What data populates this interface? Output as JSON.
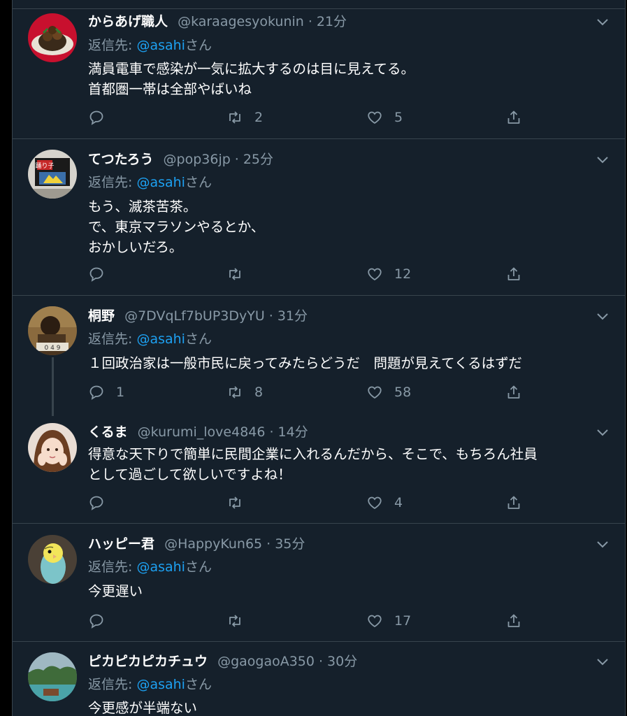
{
  "reply_prefix": "返信先: ",
  "reply_suffix": "さん",
  "tweets": [
    {
      "name": "からあげ職人",
      "handle": "@karaagesyokunin",
      "time": "21分",
      "reply_to": "@asahi",
      "body": "満員電車で感染が一気に拡大するのは目に見えてる。\n首都圏一帯は全部やばいね",
      "replies": "",
      "retweets": "2",
      "likes": "5",
      "avatar_icon": "food-avatar"
    },
    {
      "name": "てつたろう",
      "handle": "@pop36jp",
      "time": "25分",
      "reply_to": "@asahi",
      "body": "もう、滅茶苦茶。\nで、東京マラソンやるとか、\nおかしいだろ。",
      "replies": "",
      "retweets": "",
      "likes": "12",
      "avatar_icon": "tv-screen-avatar",
      "avatar_text": "踊り子"
    },
    {
      "name": "桐野",
      "handle": "@7DVqLf7bUP3DyYU",
      "time": "31分",
      "reply_to": "@asahi",
      "body": "１回政治家は一般市民に戻ってみたらどうだ　問題が見えてくるはずだ",
      "replies": "1",
      "retweets": "8",
      "likes": "58",
      "avatar_icon": "person-avatar"
    },
    {
      "name": "くるま",
      "handle": "@kurumi_love4846",
      "time": "14分",
      "reply_to": "",
      "body": "得意な天下りで簡単に民間企業に入れるんだから、そこで、もちろん社員\nとして過ごして欲しいですよね！",
      "replies": "",
      "retweets": "",
      "likes": "4",
      "avatar_icon": "girl-avatar"
    },
    {
      "name": "ハッピー君",
      "handle": "@HappyKun65",
      "time": "35分",
      "reply_to": "@asahi",
      "body": "今更遅い",
      "replies": "",
      "retweets": "",
      "likes": "17",
      "avatar_icon": "parakeet-avatar"
    },
    {
      "name": "ピカピカピカチュウ",
      "handle": "@gaogaoA350",
      "time": "30分",
      "reply_to": "@asahi",
      "body": "今更感が半端ない",
      "replies": "",
      "retweets": "",
      "likes": "",
      "avatar_icon": "landscape-avatar"
    }
  ],
  "colors": {
    "background": "#15202b",
    "border": "#38444d",
    "secondary_text": "#8899a6",
    "link": "#1da1f2"
  },
  "icons": [
    "reply-icon",
    "retweet-icon",
    "like-icon",
    "share-icon",
    "chevron-down-icon"
  ]
}
